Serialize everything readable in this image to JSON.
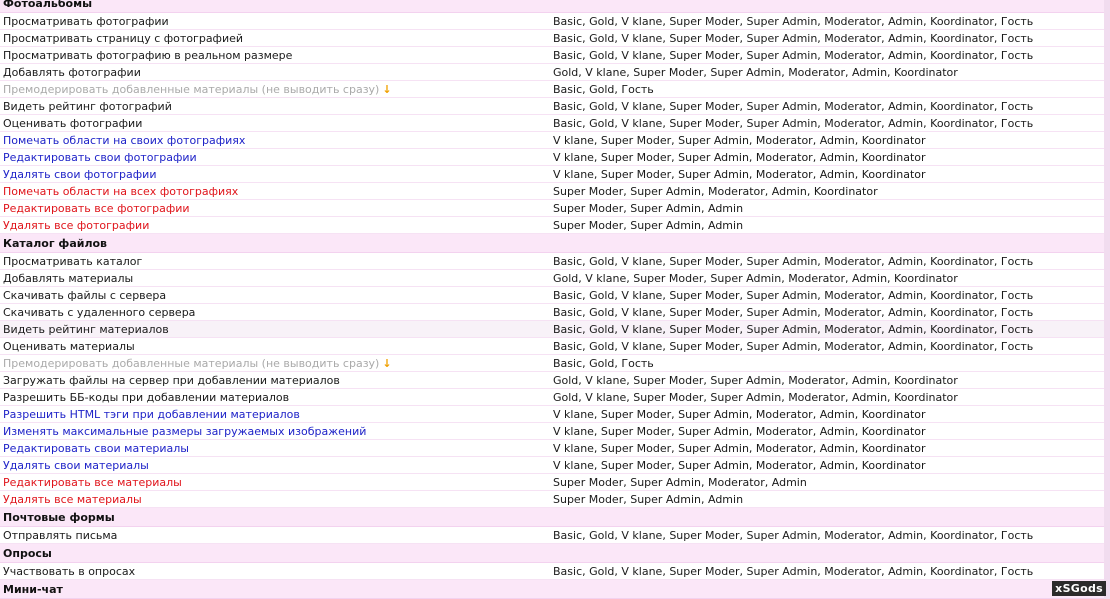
{
  "sections": [
    {
      "title": "Фотоальбомы",
      "rows": [
        {
          "name": "Просматривать фотографии",
          "groups": "Basic, Gold, V klane, Super Moder, Super Admin, Moderator, Admin, Koordinator, Гость",
          "style": "normal"
        },
        {
          "name": "Просматривать страницу с фотографией",
          "groups": "Basic, Gold, V klane, Super Moder, Super Admin, Moderator, Admin, Koordinator, Гость",
          "style": "normal"
        },
        {
          "name": "Просматривать фотографию в реальном размере",
          "groups": "Basic, Gold, V klane, Super Moder, Super Admin, Moderator, Admin, Koordinator, Гость",
          "style": "normal"
        },
        {
          "name": "Добавлять фотографии",
          "groups": "Gold, V klane, Super Moder, Super Admin, Moderator, Admin, Koordinator",
          "style": "normal"
        },
        {
          "name": "Премодерировать добавленные материалы (не выводить сразу)",
          "groups": "Basic, Gold, Гость",
          "style": "gray",
          "arrow": "↓"
        },
        {
          "name": "Видеть рейтинг фотографий",
          "groups": "Basic, Gold, V klane, Super Moder, Super Admin, Moderator, Admin, Koordinator, Гость",
          "style": "normal"
        },
        {
          "name": "Оценивать фотографии",
          "groups": "Basic, Gold, V klane, Super Moder, Super Admin, Moderator, Admin, Koordinator, Гость",
          "style": "normal"
        },
        {
          "name": "Помечать области на своих фотографиях",
          "groups": "V klane, Super Moder, Super Admin, Moderator, Admin, Koordinator",
          "style": "blue"
        },
        {
          "name": "Редактировать свои фотографии",
          "groups": "V klane, Super Moder, Super Admin, Moderator, Admin, Koordinator",
          "style": "blue"
        },
        {
          "name": "Удалять свои фотографии",
          "groups": "V klane, Super Moder, Super Admin, Moderator, Admin, Koordinator",
          "style": "blue"
        },
        {
          "name": "Помечать области на всех фотографиях",
          "groups": "Super Moder, Super Admin, Moderator, Admin, Koordinator",
          "style": "red"
        },
        {
          "name": "Редактировать все фотографии",
          "groups": "Super Moder, Super Admin, Admin",
          "style": "red"
        },
        {
          "name": "Удалять все фотографии",
          "groups": "Super Moder, Super Admin, Admin",
          "style": "red"
        }
      ]
    },
    {
      "title": "Каталог файлов",
      "rows": [
        {
          "name": "Просматривать каталог",
          "groups": "Basic, Gold, V klane, Super Moder, Super Admin, Moderator, Admin, Koordinator, Гость",
          "style": "normal"
        },
        {
          "name": "Добавлять материалы",
          "groups": "Gold, V klane, Super Moder, Super Admin, Moderator, Admin, Koordinator",
          "style": "normal"
        },
        {
          "name": "Скачивать файлы с сервера",
          "groups": "Basic, Gold, V klane, Super Moder, Super Admin, Moderator, Admin, Koordinator, Гость",
          "style": "normal"
        },
        {
          "name": "Скачивать с удаленного сервера",
          "groups": "Basic, Gold, V klane, Super Moder, Super Admin, Moderator, Admin, Koordinator, Гость",
          "style": "normal"
        },
        {
          "name": "Видеть рейтинг материалов",
          "groups": "Basic, Gold, V klane, Super Moder, Super Admin, Moderator, Admin, Koordinator, Гость",
          "style": "normal",
          "highlight": true
        },
        {
          "name": "Оценивать материалы",
          "groups": "Basic, Gold, V klane, Super Moder, Super Admin, Moderator, Admin, Koordinator, Гость",
          "style": "normal"
        },
        {
          "name": "Премодерировать добавленные материалы (не выводить сразу)",
          "groups": "Basic, Gold, Гость",
          "style": "gray",
          "arrow": "↓"
        },
        {
          "name": "Загружать файлы на сервер при добавлении материалов",
          "groups": "Gold, V klane, Super Moder, Super Admin, Moderator, Admin, Koordinator",
          "style": "normal"
        },
        {
          "name": "Разрешить ББ-коды при добавлении материалов",
          "groups": "Gold, V klane, Super Moder, Super Admin, Moderator, Admin, Koordinator",
          "style": "normal"
        },
        {
          "name": "Разрешить HTML тэги при добавлении материалов",
          "groups": "V klane, Super Moder, Super Admin, Moderator, Admin, Koordinator",
          "style": "blue"
        },
        {
          "name": "Изменять максимальные размеры загружаемых изображений",
          "groups": "V klane, Super Moder, Super Admin, Moderator, Admin, Koordinator",
          "style": "blue"
        },
        {
          "name": "Редактировать свои материалы",
          "groups": "V klane, Super Moder, Super Admin, Moderator, Admin, Koordinator",
          "style": "blue"
        },
        {
          "name": "Удалять свои материалы",
          "groups": "V klane, Super Moder, Super Admin, Moderator, Admin, Koordinator",
          "style": "blue"
        },
        {
          "name": "Редактировать все материалы",
          "groups": "Super Moder, Super Admin, Moderator, Admin",
          "style": "red"
        },
        {
          "name": "Удалять все материалы",
          "groups": "Super Moder, Super Admin, Admin",
          "style": "red"
        }
      ]
    },
    {
      "title": "Почтовые формы",
      "rows": [
        {
          "name": "Отправлять письма",
          "groups": "Basic, Gold, V klane, Super Moder, Super Admin, Moderator, Admin, Koordinator, Гость",
          "style": "normal"
        }
      ]
    },
    {
      "title": "Опросы",
      "rows": [
        {
          "name": "Участвовать в опросах",
          "groups": "Basic, Gold, V klane, Super Moder, Super Admin, Moderator, Admin, Koordinator, Гость",
          "style": "normal"
        }
      ]
    },
    {
      "title": "Мини-чат",
      "rows": []
    }
  ],
  "watermark": "xSGods",
  "colors": {
    "section_bg": "#fbe7f8",
    "blue_text": "#1f23c8",
    "red_text": "#e0141b",
    "gray_text": "#aaaaaa",
    "arrow": "#f0a000"
  }
}
